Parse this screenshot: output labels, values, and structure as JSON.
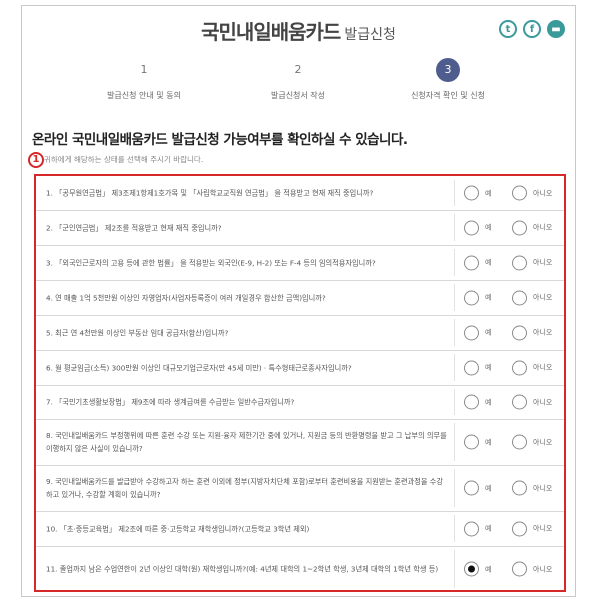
{
  "header": {
    "title_main": "국민내일배움카드",
    "title_sub": "발급신청"
  },
  "social": {
    "icons": [
      "twitter-icon",
      "facebook-icon",
      "print-icon"
    ],
    "twitter_glyph": "t",
    "facebook_glyph": "f",
    "print_glyph": "▬"
  },
  "steps": [
    {
      "num": "1",
      "label": "발급신청 안내 및 동의",
      "active": false
    },
    {
      "num": "2",
      "label": "발급신청서 작성",
      "active": false
    },
    {
      "num": "3",
      "label": "신청자격 확인 및 신청",
      "active": true
    }
  ],
  "main": {
    "heading": "온라인 국민내일배움카드 발급신청 가능여부를 확인하실 수 있습니다.",
    "badge": "1",
    "subheading": "귀하에게 해당하는 상태를 선택해 주시기 바랍니다."
  },
  "options": {
    "yes": "예",
    "no": "아니오"
  },
  "questions": [
    {
      "text": "1. 「공무원연금법」 제3조제1항제1호가목 및 「사립학교교직원 연금법」 을 적용받고 현재 재직 중입니까?",
      "answer": null
    },
    {
      "text": "2. 「군인연금법」 제2조를 적용받고 현재 재직 중입니까?",
      "answer": null
    },
    {
      "text": "3. 「외국인근로자의 고용 등에 관한 법률」 을 적용받는 외국인(E-9, H-2) 또는 F-4 등의 임의적용자입니까?",
      "answer": null
    },
    {
      "text": "4. 연 매출 1억 5천만원 이상인 자영업자(사업자등록증이 여러 개일경우 합산한 금액)입니까?",
      "answer": null
    },
    {
      "text": "5. 최근 연 4천만원 이상인 부동산 임대 공급자(합산)입니까?",
      "answer": null
    },
    {
      "text": "6. 월 평균임금(소득) 300만원 이상인 대규모기업근로자(만 45세 미만) · 특수형태근로종사자입니까?",
      "answer": null
    },
    {
      "text": "7. 「국민기초생활보장법」 제9조에 따라 생계급여를 수급받는 일반수급자입니까?",
      "answer": null
    },
    {
      "text": "8. 국민내일배움카드 부정행위에 따른 훈련 수강 또는 지원·융자 제한기간 중에 있거나, 지원금 등의 반환명령을 받고 그 납부의 의무를 이행하지 않은 사실이 있습니까?",
      "answer": null
    },
    {
      "text": "9. 국민내일배움카드를 발급받아 수강하고자 하는 훈련 이외에 정부(지방자치단체 포함)로부터 훈련비용을 지원받는 훈련과정을 수강하고 있거나, 수강할 계획이 있습니까?",
      "answer": null
    },
    {
      "text": "10. 「초·중등교육법」 제2조에 따른 중·고등학교 재학생입니까?(고등학교 3학년 제외)",
      "answer": null
    },
    {
      "text": "11. 졸업까지 남은 수업연한이 2년 이상인 대학(원) 재학생입니까?(예: 4년제 대학의 1~2학년 학생, 3년제 대학의 1학년 학생 등)",
      "answer": "yes"
    }
  ]
}
